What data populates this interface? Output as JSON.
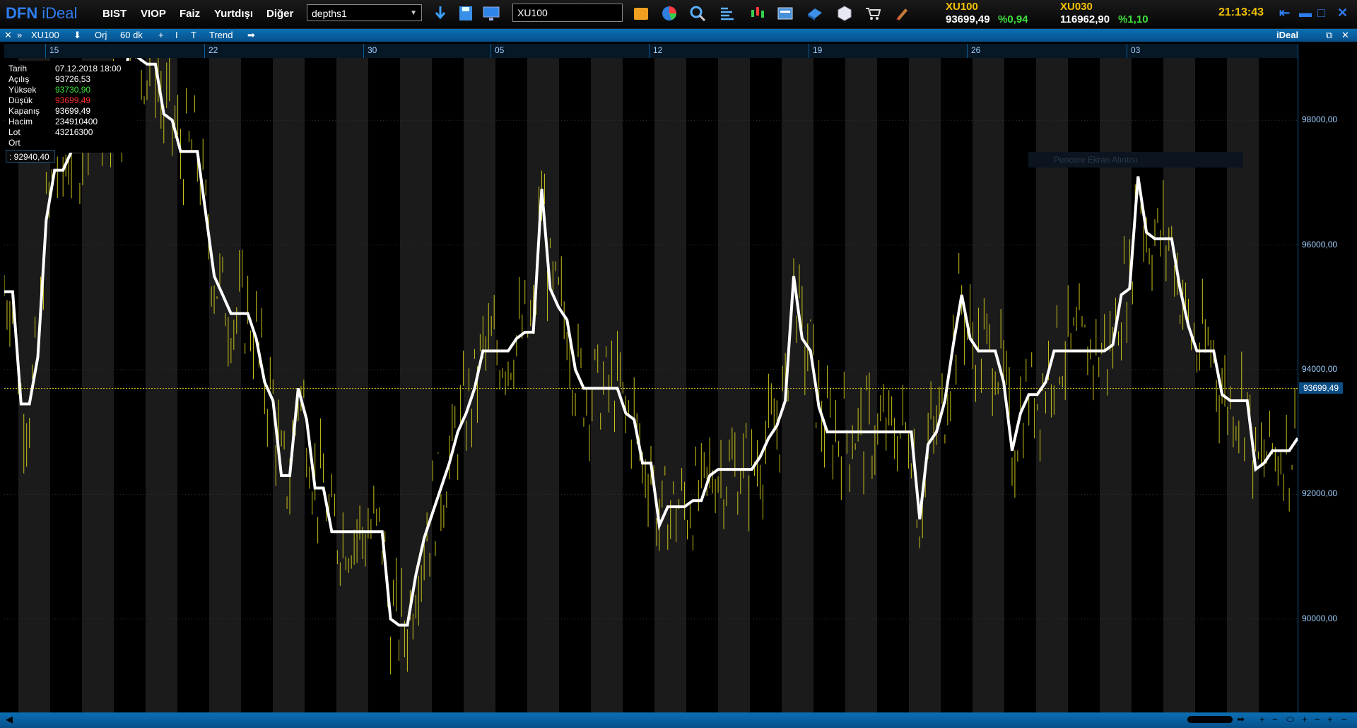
{
  "app": {
    "logo_dfn": "DFN",
    "logo_ideal": "iDeal"
  },
  "menu": [
    "BIST",
    "VIOP",
    "Faiz",
    "Yurtdışı",
    "Diğer"
  ],
  "layout_select": {
    "value": "depths1"
  },
  "symbol_input": {
    "value": "XU100"
  },
  "toolbar_icons": [
    "folder-icon",
    "pie-chart-icon",
    "search-icon",
    "bar-list-icon",
    "candlestick-icon",
    "news-icon",
    "disk-icon",
    "cube-icon",
    "cart-icon",
    "paint-icon"
  ],
  "quotes": [
    {
      "name": "XU100",
      "value": "93699,49",
      "pct": "%0,94"
    },
    {
      "name": "XU030",
      "value": "116962,90",
      "pct": "%1,10"
    }
  ],
  "clock": "21:13:43",
  "chart_toolbar": {
    "symbol": "XU100",
    "orj": "Orj",
    "period": "60 dk",
    "trend": "Trend",
    "title": "iDeal"
  },
  "chart_data": {
    "type": "line",
    "x_labels": [
      "15",
      "22",
      "30",
      "05",
      "12",
      "19",
      "26",
      "03"
    ],
    "y_ticks": [
      "98000,00",
      "96000,00",
      "94000,00",
      "92000,00",
      "90000,00"
    ],
    "ylim": [
      88500,
      99000
    ],
    "last_price": "93699,49",
    "series": [
      {
        "values": [
          95250,
          95250,
          93450,
          93450,
          94200,
          96400,
          97200,
          97200,
          97500,
          97500,
          98100,
          98100,
          98100,
          98100,
          98100,
          99350,
          99000,
          98900,
          98900,
          98100,
          98000,
          97500,
          97500,
          97500,
          96500,
          95500,
          95200,
          94900,
          94900,
          94900,
          94500,
          93800,
          93500,
          92300,
          92300,
          93700,
          93200,
          92100,
          92100,
          91400,
          91400,
          91400,
          91400,
          91400,
          91400,
          91400,
          90000,
          89900,
          89900,
          90700,
          91300,
          91700,
          92100,
          92500,
          93000,
          93300,
          93700,
          94300,
          94300,
          94300,
          94300,
          94500,
          94600,
          94600,
          96900,
          95300,
          95000,
          94800,
          94000,
          93700,
          93700,
          93700,
          93700,
          93700,
          93300,
          93200,
          92500,
          92500,
          91500,
          91800,
          91800,
          91800,
          91900,
          91900,
          92300,
          92400,
          92400,
          92400,
          92400,
          92400,
          92600,
          92900,
          93100,
          93500,
          95500,
          94500,
          94300,
          93400,
          93000,
          93000,
          93000,
          93000,
          93000,
          93000,
          93000,
          93000,
          93000,
          93000,
          93000,
          91600,
          92800,
          93000,
          93500,
          94400,
          95200,
          94500,
          94300,
          94300,
          94300,
          93800,
          92700,
          93300,
          93600,
          93600,
          93800,
          94300,
          94300,
          94300,
          94300,
          94300,
          94300,
          94300,
          94400,
          95200,
          95300,
          97100,
          96200,
          96100,
          96100,
          96100,
          95300,
          94700,
          94300,
          94300,
          94300,
          93600,
          93500,
          93500,
          93500,
          92400,
          92500,
          92700,
          92700,
          92700,
          92900
        ]
      }
    ]
  },
  "price_bars": "yellow OHLC bars overlay",
  "info_panel": {
    "labels": [
      "Tarih",
      "Açılış",
      "Yüksek",
      "Düşük",
      "Kapanış",
      "Hacim",
      "Lot",
      "Ort"
    ],
    "values": [
      "07.12.2018 18:00",
      "93726,53",
      "93730,90",
      "93699,49",
      "93699,49",
      "234910400",
      "43216300",
      ""
    ],
    "value_colors": [
      "#ffffff",
      "#ffffff",
      "#3ce03c",
      "#ff3030",
      "#ffffff",
      "#ffffff",
      "#ffffff",
      "#ffffff"
    ],
    "cursor_value": ": 92940,40"
  },
  "ghost_label": "Pencere Ekran Alıntısı"
}
